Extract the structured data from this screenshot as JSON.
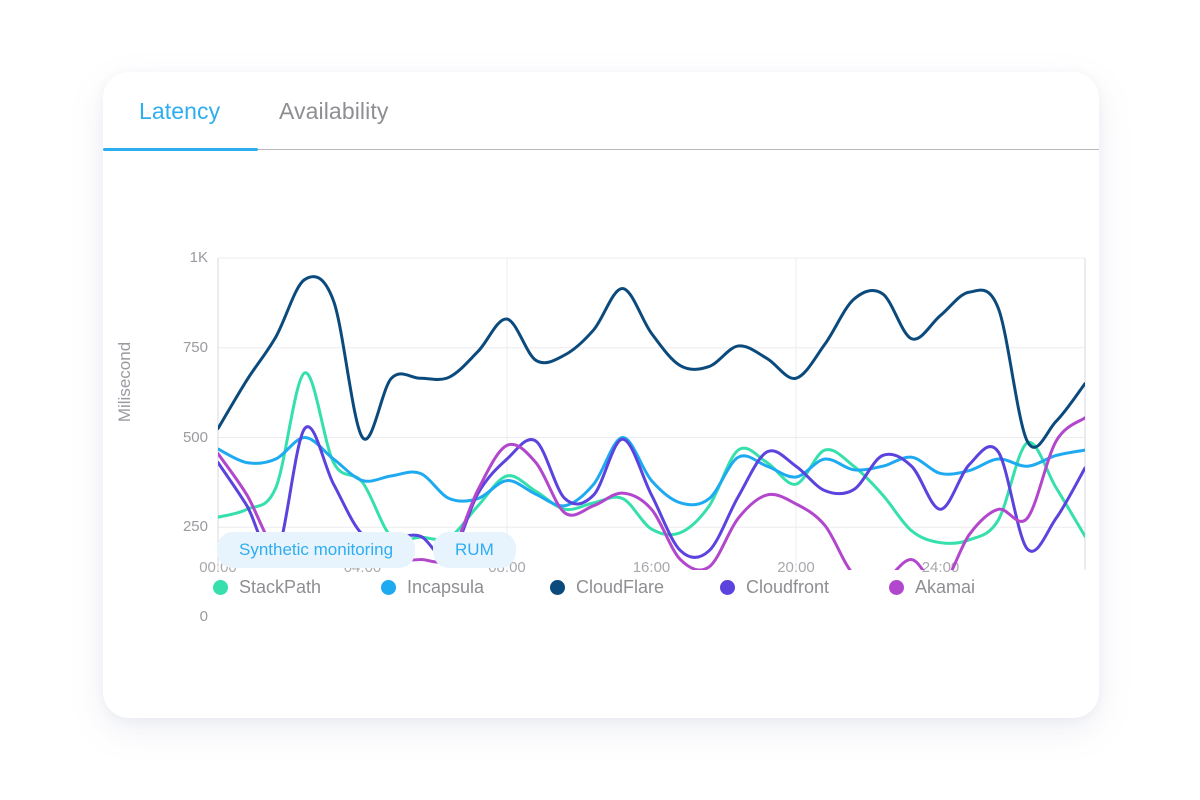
{
  "card": {
    "tabs": [
      {
        "id": "latency",
        "label": "Latency",
        "active": true
      },
      {
        "id": "availability",
        "label": "Availability",
        "active": false
      }
    ],
    "filters": [
      {
        "id": "synthetic",
        "label": "Synthetic monitoring"
      },
      {
        "id": "rum",
        "label": "RUM"
      }
    ]
  },
  "colors": {
    "accent": "#2eadf0",
    "chip_bg": "#e8f4fd",
    "grid": "#ececf0",
    "axis": "#d8d8de",
    "tick_text": "#9a9aa0",
    "legend_text": "#8e8e93",
    "tab_inactive": "#8e8e93",
    "card_bg": "#ffffff"
  },
  "chart_data": {
    "type": "line",
    "title": "Latency",
    "xlabel": "",
    "ylabel": "Milisecond",
    "ylim": [
      0,
      1000
    ],
    "yticks": [
      0,
      250,
      500,
      750,
      1000
    ],
    "ytick_labels": [
      "0",
      "250",
      "500",
      "750",
      "1K"
    ],
    "xlim": [
      0,
      24
    ],
    "xticks": [
      0,
      4,
      8,
      12,
      16,
      20,
      24
    ],
    "xtick_labels": [
      "00:00",
      "04:00",
      "08:00",
      "16:00",
      "20:00",
      "24:00"
    ],
    "xtick_label_positions": [
      0,
      4,
      8,
      12,
      16,
      20
    ],
    "grid": {
      "horizontal": true,
      "vertical": true
    },
    "legend_position": "bottom",
    "x": [
      0,
      0.8,
      1.6,
      2.4,
      3.2,
      4.0,
      4.8,
      5.6,
      6.4,
      7.2,
      8.0,
      8.8,
      9.6,
      10.4,
      11.2,
      12.0,
      12.8,
      13.6,
      14.4,
      15.2,
      16.0,
      16.8,
      17.6,
      18.4,
      19.2,
      20.0,
      20.8,
      21.6,
      22.4,
      23.2,
      24.0
    ],
    "series": [
      {
        "name": "StackPath",
        "color": "#35e0ac",
        "values": [
          278,
          300,
          360,
          680,
          430,
          375,
          223,
          222,
          222,
          310,
          393,
          350,
          300,
          318,
          330,
          245,
          235,
          310,
          465,
          430,
          370,
          465,
          420,
          340,
          240,
          207,
          215,
          270,
          485,
          360,
          225
        ]
      },
      {
        "name": "Incapsula",
        "color": "#1eaaf1",
        "values": [
          468,
          430,
          440,
          500,
          440,
          380,
          393,
          400,
          330,
          330,
          380,
          342,
          310,
          370,
          500,
          380,
          318,
          330,
          445,
          420,
          390,
          440,
          410,
          420,
          445,
          400,
          408,
          440,
          420,
          450,
          465
        ]
      },
      {
        "name": "CloudFlare",
        "color": "#0b4a7c",
        "values": [
          525,
          660,
          780,
          940,
          880,
          500,
          665,
          665,
          668,
          740,
          830,
          715,
          730,
          800,
          915,
          790,
          700,
          698,
          755,
          720,
          665,
          760,
          885,
          900,
          775,
          840,
          905,
          860,
          490,
          545,
          650
        ]
      },
      {
        "name": "Cloudfront",
        "color": "#5b43dd",
        "values": [
          430,
          310,
          170,
          525,
          370,
          230,
          220,
          225,
          165,
          345,
          440,
          490,
          330,
          340,
          495,
          340,
          185,
          185,
          335,
          460,
          420,
          352,
          355,
          450,
          420,
          300,
          425,
          460,
          190,
          275,
          415
        ]
      },
      {
        "name": "Akamai",
        "color": "#b247cd",
        "values": [
          455,
          340,
          190,
          222,
          218,
          180,
          160,
          160,
          170,
          355,
          478,
          430,
          290,
          310,
          345,
          300,
          160,
          140,
          275,
          340,
          315,
          255,
          118,
          100,
          160,
          85,
          230,
          300,
          275,
          490,
          555
        ]
      }
    ]
  }
}
